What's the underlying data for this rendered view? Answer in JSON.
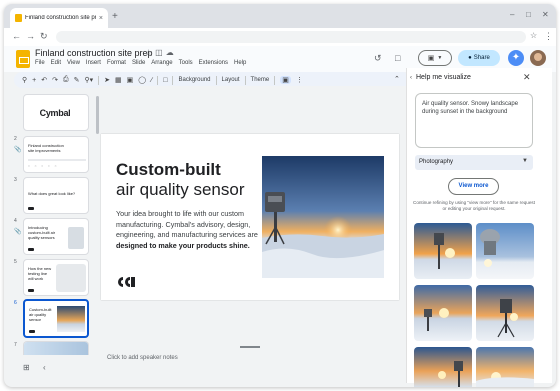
{
  "browser": {
    "tab_title": "Finland construction site prep",
    "new_tab": "+",
    "close_tab": "×"
  },
  "doc": {
    "title": "Finland construction site prep",
    "menu": [
      "File",
      "Edit",
      "View",
      "Insert",
      "Format",
      "Slide",
      "Arrange",
      "Tools",
      "Extensions",
      "Help"
    ],
    "share_label": "Share"
  },
  "toolbar": {
    "background": "Background",
    "layout": "Layout",
    "theme": "Theme"
  },
  "filmstrip": {
    "slides": [
      {
        "num": "1",
        "text": "Cymbal"
      },
      {
        "num": "2",
        "text": "Finland construction site improvements"
      },
      {
        "num": "3",
        "text": "What does great look like?"
      },
      {
        "num": "4",
        "text": "Introducing custom-built air quality sensors"
      },
      {
        "num": "5",
        "text": "How the new testing line will work"
      },
      {
        "num": "6",
        "text": "Custom-built air quality sensor"
      },
      {
        "num": "7",
        "text": ""
      }
    ]
  },
  "slide": {
    "title_line1": "Custom-built",
    "title_line2": "air quality sensor",
    "body_plain": "Your idea brought to life with our custom manufacturing. Cymbal's advisory, design, engineering, and manufacturing services are ",
    "body_bold": "designed to make your products shine."
  },
  "notes": {
    "placeholder": "Click to add speaker notes"
  },
  "panel": {
    "title": "Help me visualize",
    "prompt": "Air quality sensor. Snowy landscape during sunset in the background",
    "style": "Photography",
    "view_more": "View more",
    "hint": "Continue refining by using \"view more\" for the same request or editing your original request."
  },
  "colors": {
    "accent": "#0b57d0",
    "share_bg": "#c2e7ff",
    "slides_yellow": "#f4b400"
  }
}
